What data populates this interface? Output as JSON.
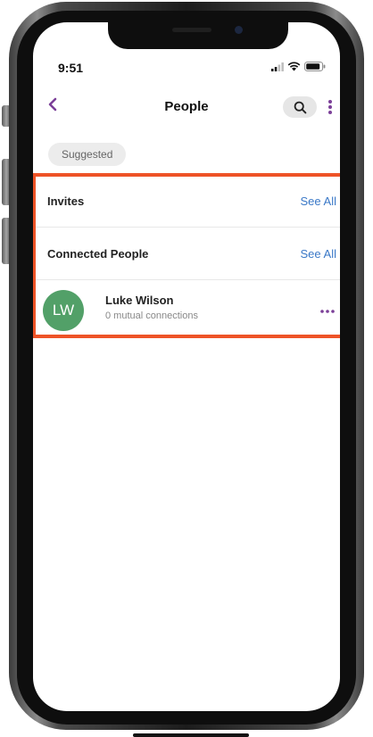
{
  "status_bar": {
    "time": "9:51",
    "icons": [
      "signal-icon",
      "wifi-icon",
      "battery-icon"
    ]
  },
  "header": {
    "title": "People",
    "back_icon": "chevron-left-icon",
    "search_icon": "search-icon",
    "more_icon": "more-vertical-icon"
  },
  "filter_chip": {
    "label": "Suggested"
  },
  "sections": [
    {
      "title": "Invites",
      "action": "See All"
    },
    {
      "title": "Connected People",
      "action": "See All"
    }
  ],
  "people": [
    {
      "initials": "LW",
      "name": "Luke Wilson",
      "subtitle": "0 mutual connections",
      "more_icon": "more-horizontal-icon"
    }
  ],
  "colors": {
    "accent": "#7b3f98",
    "link": "#3a78c7",
    "avatar": "#52a068",
    "highlight": "#ee5327"
  }
}
